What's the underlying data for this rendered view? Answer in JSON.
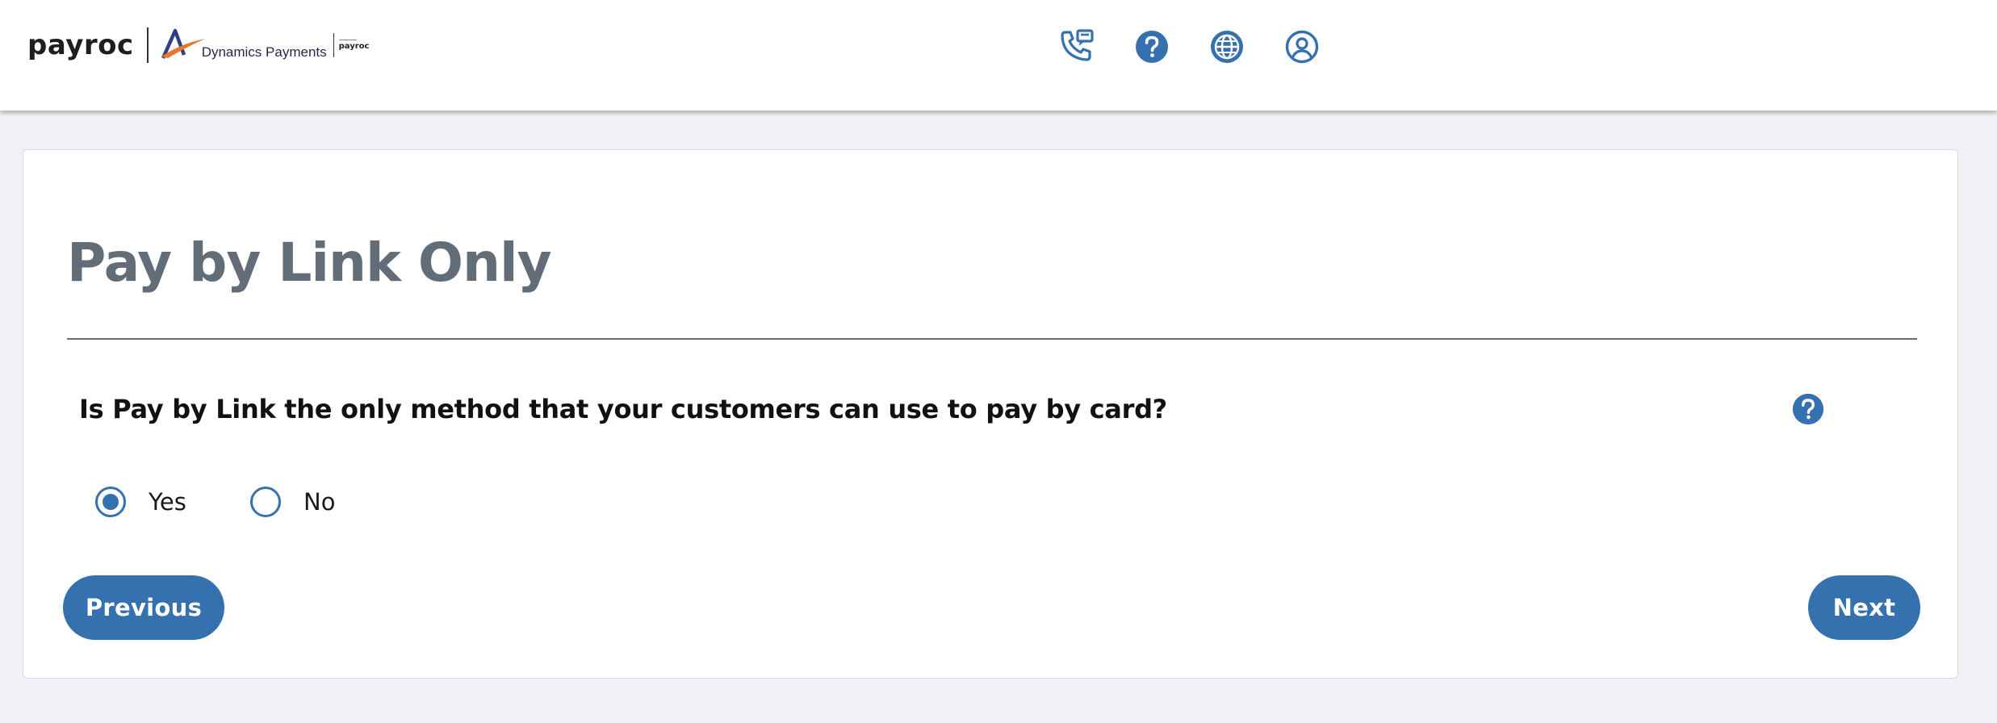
{
  "header": {
    "brand": "payroc",
    "partner_logo_text": "Dynamics Payments",
    "partner_sub_brand": "payroc",
    "icons": [
      "phone-chat-icon",
      "help-icon",
      "globe-icon",
      "user-account-icon"
    ]
  },
  "main": {
    "title": "Pay by Link Only",
    "question": "Is Pay by Link the only method that your customers can use to pay by card?",
    "help_icon": "help-icon",
    "options": [
      {
        "label": "Yes",
        "selected": true
      },
      {
        "label": "No",
        "selected": false
      }
    ],
    "previous_label": "Previous",
    "next_label": "Next"
  },
  "colors": {
    "accent": "#3571ae",
    "title": "#636d77",
    "background": "#f0f1f5",
    "logo_orange": "#e8772e",
    "logo_navy": "#2f3f86"
  }
}
